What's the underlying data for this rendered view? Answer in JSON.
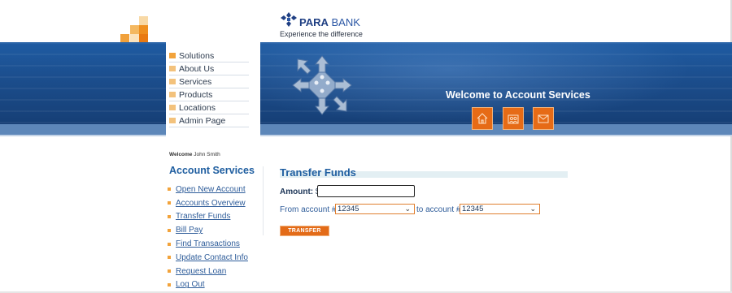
{
  "brand": {
    "name_bold": "PARA",
    "name_light": " BANK",
    "tagline": "Experience the difference"
  },
  "header": {
    "welcome_title": "Welcome to Account Services"
  },
  "top_menu": [
    {
      "label": "Solutions"
    },
    {
      "label": "About Us"
    },
    {
      "label": "Services"
    },
    {
      "label": "Products"
    },
    {
      "label": "Locations"
    },
    {
      "label": "Admin Page"
    }
  ],
  "header_icons": [
    {
      "name": "home-icon"
    },
    {
      "name": "about-icon"
    },
    {
      "name": "contact-icon"
    }
  ],
  "user": {
    "welcome_word": "Welcome",
    "name": "John Smith"
  },
  "account_services": {
    "title": "Account Services",
    "links": [
      {
        "label": "Open New Account"
      },
      {
        "label": "Accounts Overview"
      },
      {
        "label": "Transfer Funds"
      },
      {
        "label": "Bill Pay"
      },
      {
        "label": "Find Transactions"
      },
      {
        "label": "Update Contact Info"
      },
      {
        "label": "Request Loan"
      },
      {
        "label": "Log Out"
      }
    ]
  },
  "transfer": {
    "title": "Transfer Funds",
    "amount_label": "Amount:",
    "currency": "$",
    "amount_value": "",
    "from_label": "From account #",
    "from_account": "12345",
    "to_label": "to account #",
    "to_account": "12345",
    "button_label": "TRANSFER"
  },
  "colors": {
    "brand_blue": "#1f5ea0",
    "accent_orange": "#e36b18",
    "band_blue": "#1c4f8f"
  }
}
